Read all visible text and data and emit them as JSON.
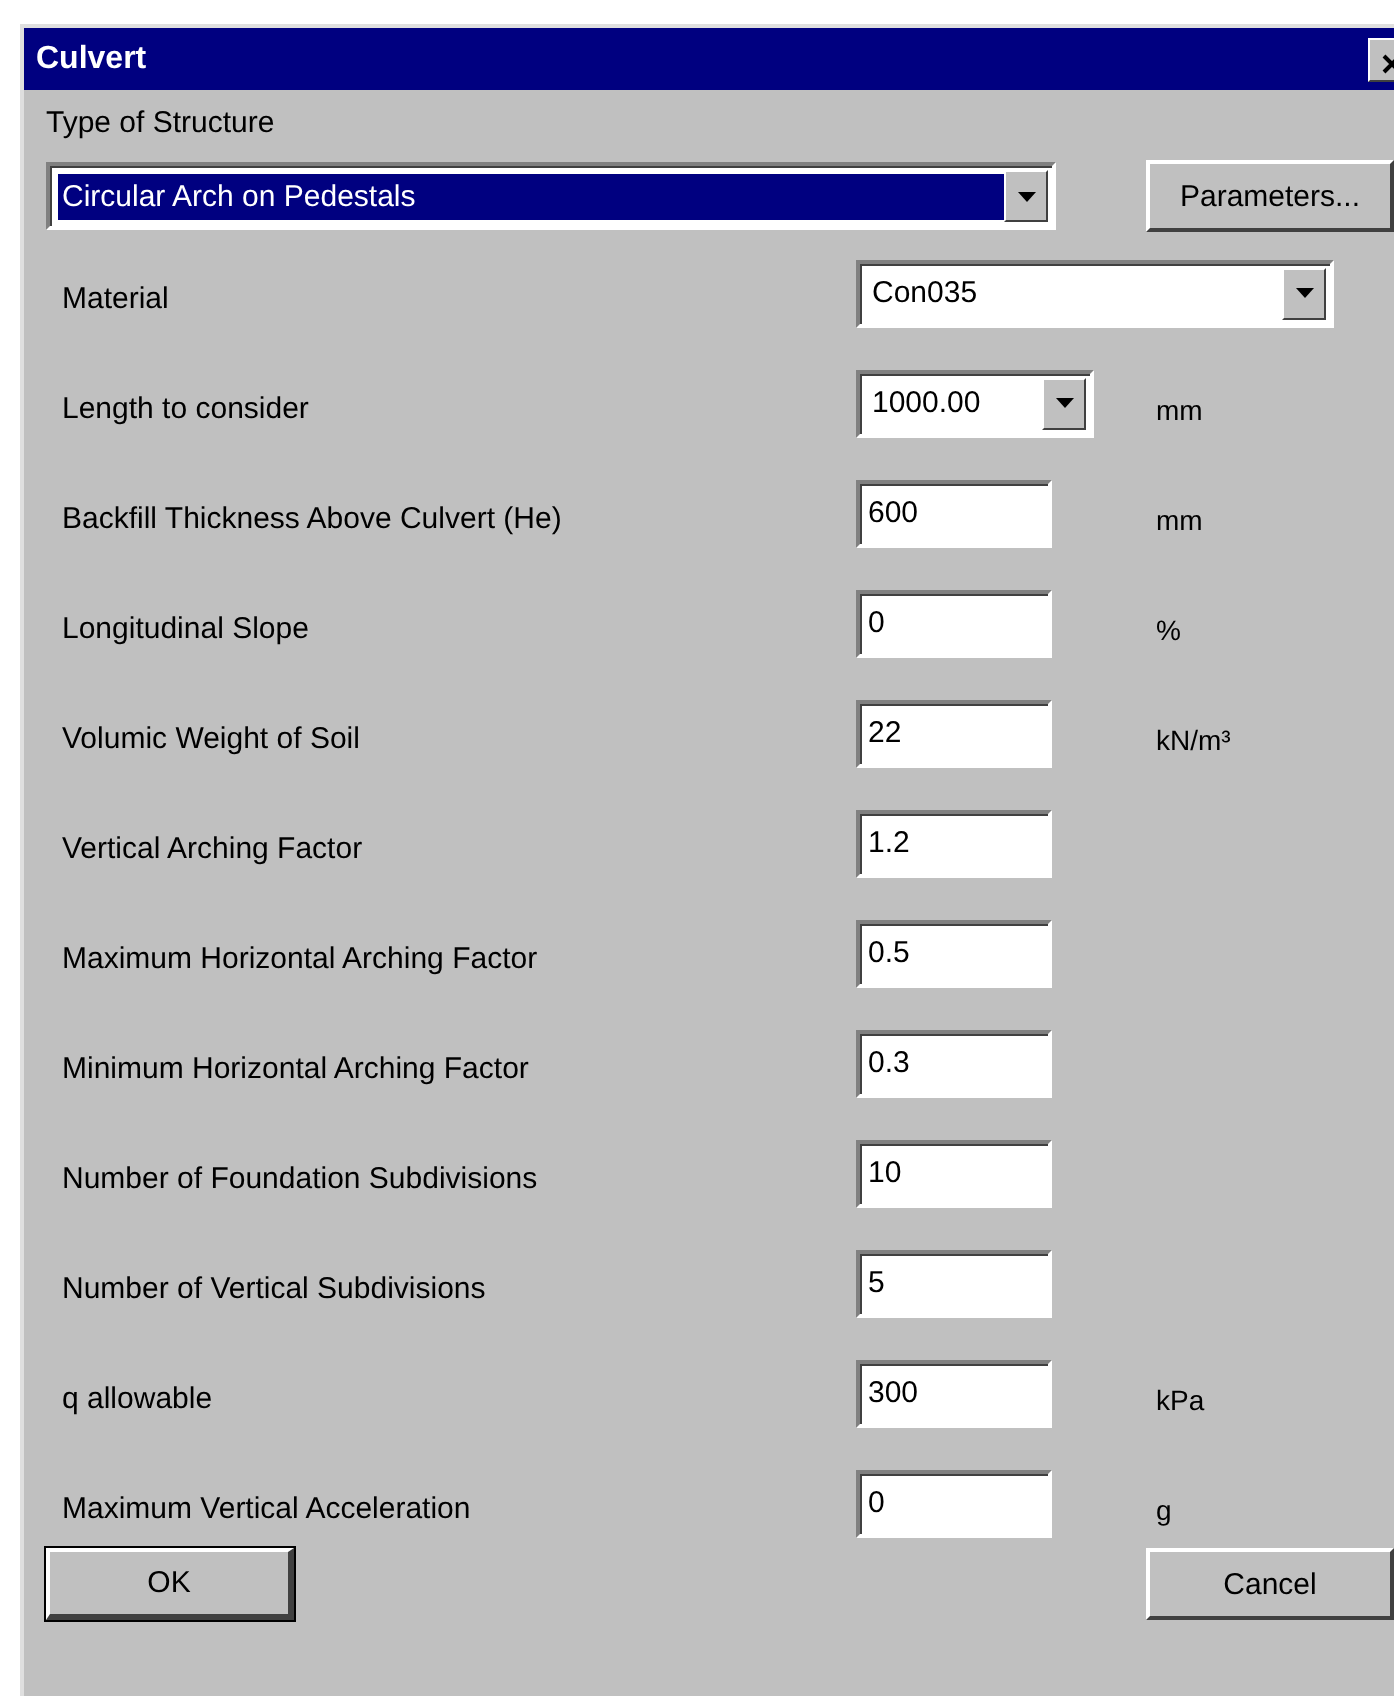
{
  "window": {
    "title": "Culvert"
  },
  "structure": {
    "label": "Type of Structure",
    "value": "Circular Arch on Pedestals",
    "focused": true,
    "button": "Parameters..."
  },
  "rows": [
    {
      "kind": "combo",
      "label": "Material",
      "value": "Con035",
      "wide": true
    },
    {
      "kind": "combo",
      "label": "Length to consider",
      "value": "1000.00",
      "unit": "mm",
      "wide": false
    },
    {
      "kind": "field",
      "label": "Backfill Thickness Above Culvert (He)",
      "value": "600",
      "unit": "mm"
    },
    {
      "kind": "field",
      "label": "Longitudinal Slope",
      "value": "0",
      "unit": "%"
    },
    {
      "kind": "field",
      "label": "Volumic Weight of Soil",
      "value": "22",
      "unit": "kN/m³"
    },
    {
      "kind": "field",
      "label": "Vertical Arching Factor",
      "value": "1.2"
    },
    {
      "kind": "field",
      "label": "Maximum Horizontal Arching Factor",
      "value": "0.5"
    },
    {
      "kind": "field",
      "label": "Minimum Horizontal Arching Factor",
      "value": "0.3"
    },
    {
      "kind": "field",
      "label": "Number of Foundation Subdivisions",
      "value": "10"
    },
    {
      "kind": "field",
      "label": "Number of Vertical Subdivisions",
      "value": "5"
    },
    {
      "kind": "field",
      "label": "q allowable",
      "value": "300",
      "unit": "kPa"
    },
    {
      "kind": "field",
      "label": "Maximum Vertical Acceleration",
      "value": "0",
      "unit": "g"
    }
  ],
  "buttons": [
    {
      "label": "OK",
      "default": true
    },
    {
      "label": "Cancel",
      "default": false
    }
  ]
}
